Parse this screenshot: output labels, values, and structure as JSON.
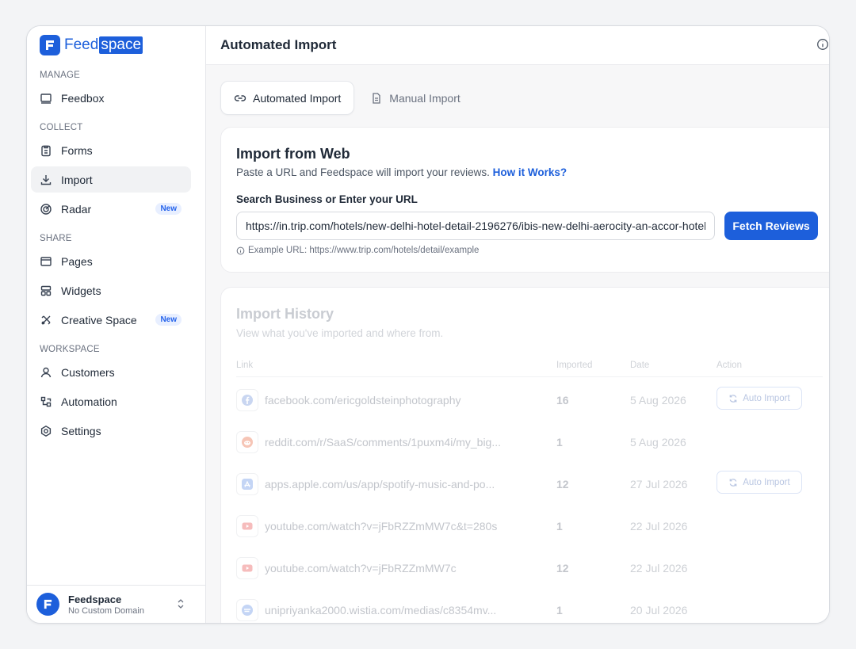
{
  "brand": {
    "name_part1": "Feed",
    "name_part2": "space",
    "color": "#1d5fdb"
  },
  "sidebar": {
    "sections": {
      "manage": "MANAGE",
      "collect": "COLLECT",
      "share": "SHARE",
      "workspace": "WORKSPACE"
    },
    "items": [
      {
        "label": "Feedbox",
        "icon": "inbox-icon"
      },
      {
        "label": "Forms",
        "icon": "clipboard-icon"
      },
      {
        "label": "Import",
        "icon": "download-icon",
        "active": true
      },
      {
        "label": "Radar",
        "icon": "radar-icon",
        "badge": "New"
      },
      {
        "label": "Pages",
        "icon": "browser-icon"
      },
      {
        "label": "Widgets",
        "icon": "layout-icon"
      },
      {
        "label": "Creative Space",
        "icon": "palette-icon",
        "badge": "New"
      },
      {
        "label": "Customers",
        "icon": "user-icon"
      },
      {
        "label": "Automation",
        "icon": "workflow-icon"
      },
      {
        "label": "Settings",
        "icon": "gear-icon"
      }
    ],
    "account": {
      "name": "Feedspace",
      "subtitle": "No Custom Domain"
    }
  },
  "header": {
    "title": "Automated Import"
  },
  "tabs": [
    {
      "label": "Automated Import",
      "icon": "link-icon",
      "active": true
    },
    {
      "label": "Manual Import",
      "icon": "document-icon",
      "active": false
    }
  ],
  "import_card": {
    "title": "Import from Web",
    "subtitle": "Paste a URL and Feedspace will import your reviews.",
    "help_link": "How it Works?",
    "field_label": "Search Business or Enter your URL",
    "url_value": "https://in.trip.com/hotels/new-delhi-hotel-detail-2196276/ibis-new-delhi-aerocity-an-accor-hotel/",
    "button": "Fetch Reviews",
    "example": "Example URL: https://www.trip.com/hotels/detail/example"
  },
  "history": {
    "title": "Import History",
    "subtitle": "View what you've imported and where from.",
    "columns": {
      "link": "Link",
      "imported": "Imported",
      "date": "Date",
      "action": "Action"
    },
    "rows": [
      {
        "source": "facebook",
        "link": "facebook.com/ericgoldsteinphotography",
        "imported": "16",
        "date": "5 Aug 2026",
        "action": "Auto Import"
      },
      {
        "source": "reddit",
        "link": "reddit.com/r/SaaS/comments/1puxm4i/my_big...",
        "imported": "1",
        "date": "5 Aug 2026",
        "action": ""
      },
      {
        "source": "appstore",
        "link": "apps.apple.com/us/app/spotify-music-and-po...",
        "imported": "12",
        "date": "27 Jul 2026",
        "action": "Auto Import"
      },
      {
        "source": "youtube",
        "link": "youtube.com/watch?v=jFbRZZmMW7c&t=280s",
        "imported": "1",
        "date": "22 Jul 2026",
        "action": ""
      },
      {
        "source": "youtube",
        "link": "youtube.com/watch?v=jFbRZZmMW7c",
        "imported": "12",
        "date": "22 Jul 2026",
        "action": ""
      },
      {
        "source": "wistia",
        "link": "unipriyanka2000.wistia.com/medias/c8354mv...",
        "imported": "1",
        "date": "20 Jul 2026",
        "action": ""
      }
    ]
  }
}
